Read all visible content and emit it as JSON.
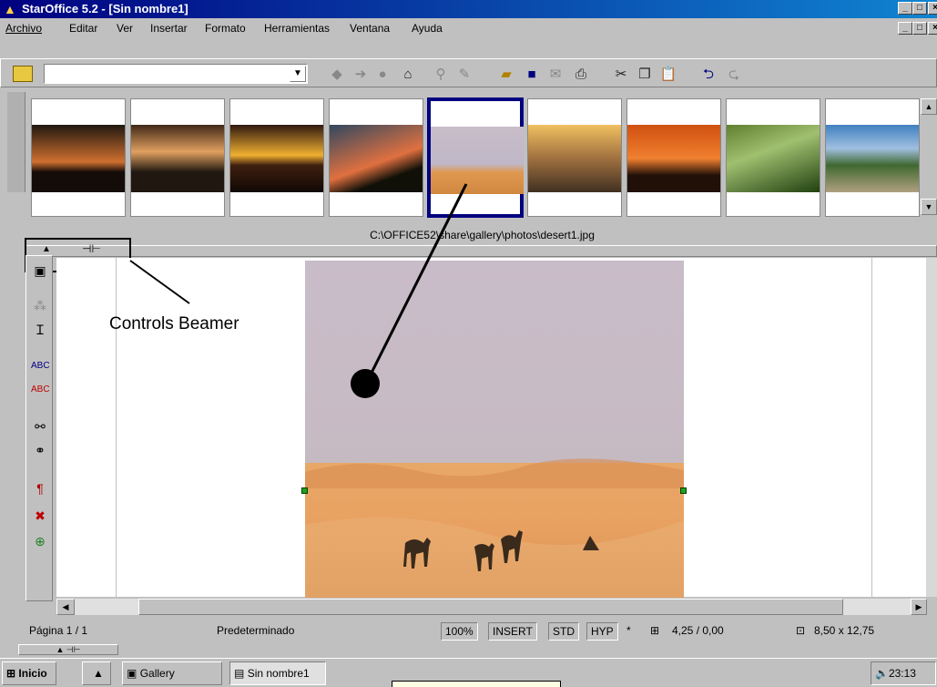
{
  "window": {
    "title": "StarOffice 5.2 - [Sin nombre1]",
    "min": "_",
    "max": "□",
    "close": "×"
  },
  "menu": [
    "Archivo",
    "Editar",
    "Ver",
    "Insertar",
    "Formato",
    "Herramientas",
    "Ventana",
    "Ayuda"
  ],
  "gallery": {
    "path": "C:\\OFFICE52\\share\\gallery\\photos\\desert1.jpg",
    "thumbnails": [
      "sunset-palms",
      "tropical-sunset",
      "sea-sunrise",
      "tree-dusk",
      "desert",
      "dunes-sunset",
      "orange-horizon",
      "forest",
      "mountain-valley"
    ],
    "selected_index": 4
  },
  "annotation": {
    "label": "Controls Beamer"
  },
  "statusbar": {
    "page": "Página  1 / 1",
    "style": "Predeterminado",
    "zoom": "100%",
    "insert": "INSERT",
    "std": "STD",
    "hyp": "HYP",
    "mark": "*",
    "position": "4,25 / 0,00",
    "size": "8,50 x 12,75"
  },
  "taskbar": {
    "start": "Inicio",
    "gallery_btn": "Gallery",
    "doc_btn": "Sin nombre1",
    "clock": "23:13"
  },
  "colors": {
    "titlebar_start": "#000080",
    "titlebar_end": "#1084d0",
    "selection_border": "#000080"
  }
}
